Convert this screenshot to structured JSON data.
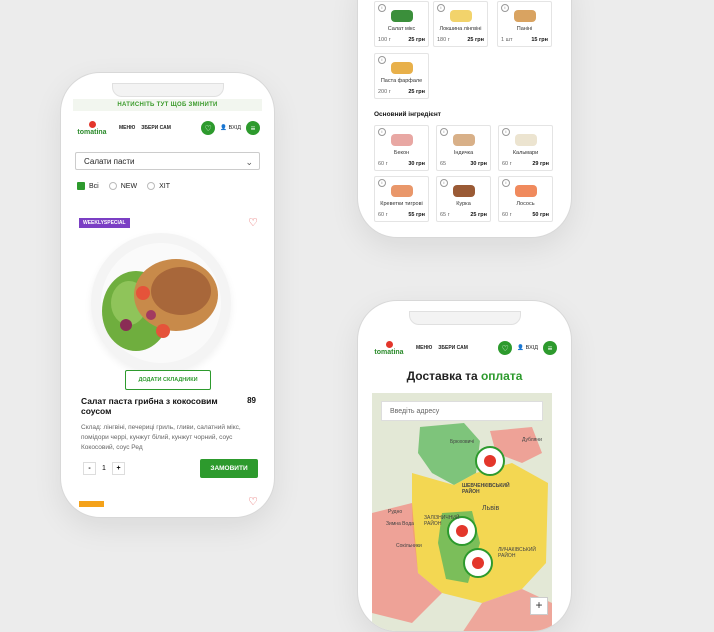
{
  "phone1": {
    "top_banner": "НАТИСНІТЬ ТУТ ЩОБ ЗМІНИТИ",
    "logo": "tomatina",
    "nav": [
      "МЕНЮ",
      "ЗБЕРИ САМ"
    ],
    "login": "ВХІД",
    "category_select": "Салати пасти",
    "filters": [
      "Всі",
      "NEW",
      "ХІТ"
    ],
    "badge": "WEEKLYSPECIAL",
    "add_ingredients": "ДОДАТИ СКЛАДНИКИ",
    "product_title": "Салат паста грибна з кокосовим соусом",
    "product_price": "89",
    "description": "Склад: лінгвіні, печериці гриль, гливи, салатний мікс, помідори черрі, кунжут білий, кунжут чорний, соус Кокосовий, соус Ред",
    "quantity": "1",
    "qty_minus": "-",
    "qty_plus": "+",
    "order_button": "ЗАМОВИТИ"
  },
  "phone2": {
    "top_items": [
      {
        "name": "Салат мікс",
        "weight": "100 г",
        "price": "25 грн",
        "color": "#3b8f3b"
      },
      {
        "name": "Локшина лінгвіні",
        "weight": "180 г",
        "price": "25 грн",
        "color": "#f2d36b"
      },
      {
        "name": "Паніні",
        "weight": "1 шт",
        "price": "15 грн",
        "color": "#d9a361"
      },
      {
        "name": "Паста фарфале",
        "weight": "200 г",
        "price": "25 грн",
        "color": "#e8b04a"
      }
    ],
    "section_title": "Основний інгредієнт",
    "main_items": [
      {
        "name": "Бекон",
        "weight": "60 г",
        "price": "30 грн",
        "color": "#e8a7a3"
      },
      {
        "name": "Індичка",
        "weight": "65",
        "price": "30 грн",
        "color": "#d8b088"
      },
      {
        "name": "Кальмари",
        "weight": "60 г",
        "price": "29 грн",
        "color": "#ece4d0"
      },
      {
        "name": "Креветки тигрові",
        "weight": "60 г",
        "price": "55 грн",
        "color": "#e9976a"
      },
      {
        "name": "Курка",
        "weight": "65 г",
        "price": "25 грн",
        "color": "#9a5a35"
      },
      {
        "name": "Лосось",
        "weight": "60 г",
        "price": "50 грн",
        "color": "#f08a5d"
      }
    ]
  },
  "phone3": {
    "logo": "tomatina",
    "nav": [
      "МЕНЮ",
      "ЗБЕРИ САМ"
    ],
    "login": "ВХІД",
    "heading_main": "Доставка та ",
    "heading_accent": "оплата",
    "address_placeholder": "Введіть адресу",
    "map_labels": [
      "Брюховичі",
      "Дубляни",
      "ШЕВЧЕНКІВСЬКИЙ РАЙОН",
      "Львів",
      "ЗАЛІЗНИЧНИЙ РАЙОН",
      "ЛИЧАКІВСЬКИЙ РАЙОН",
      "Рудно",
      "Зимна Вода",
      "Сокільники"
    ],
    "zoom_in": "+"
  }
}
